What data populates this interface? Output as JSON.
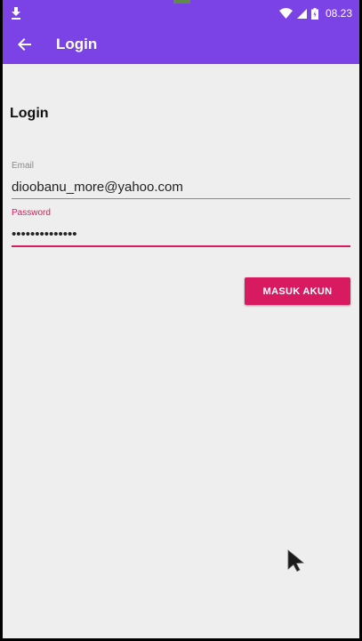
{
  "status_bar": {
    "time": "08.23",
    "icons": [
      "download-icon",
      "wifi-icon",
      "signal-icon",
      "battery-icon"
    ]
  },
  "app_bar": {
    "title": "Login",
    "back_icon": "arrow-back-icon"
  },
  "form": {
    "heading": "Login",
    "email": {
      "label": "Email",
      "value": "dioobanu_more@yahoo.com"
    },
    "password": {
      "label": "Password",
      "value": "••••••••••••••"
    },
    "submit_label": "MASUK AKUN"
  },
  "colors": {
    "primary": "#7b42e6",
    "accent": "#d81b60",
    "background": "#eeeeee"
  }
}
